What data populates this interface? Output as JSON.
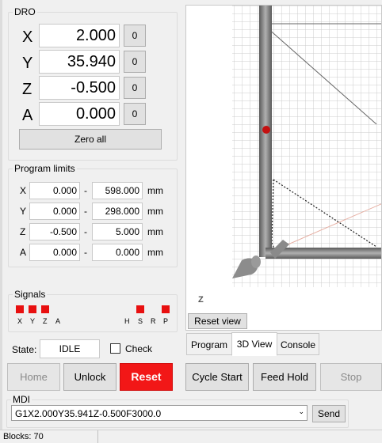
{
  "dro": {
    "title": "DRO",
    "axes": [
      {
        "label": "X",
        "value": "2.000",
        "zero": "0"
      },
      {
        "label": "Y",
        "value": "35.940",
        "zero": "0"
      },
      {
        "label": "Z",
        "value": "-0.500",
        "zero": "0"
      },
      {
        "label": "A",
        "value": "0.000",
        "zero": "0"
      }
    ],
    "zero_all": "Zero all"
  },
  "limits": {
    "title": "Program limits",
    "rows": [
      {
        "axis": "X",
        "min": "0.000",
        "max": "598.000",
        "unit": "mm"
      },
      {
        "axis": "Y",
        "min": "0.000",
        "max": "298.000",
        "unit": "mm"
      },
      {
        "axis": "Z",
        "min": "-0.500",
        "max": "5.000",
        "unit": "mm"
      },
      {
        "axis": "A",
        "min": "0.000",
        "max": "0.000",
        "unit": "mm"
      }
    ],
    "dash": "-"
  },
  "signals": {
    "title": "Signals",
    "labels": [
      "X",
      "Y",
      "Z",
      "A",
      "H",
      "S",
      "R",
      "P"
    ],
    "led_color": "#e81010"
  },
  "state": {
    "label": "State:",
    "value": "IDLE",
    "check_label": "Check"
  },
  "buttons": {
    "home": "Home",
    "unlock": "Unlock",
    "reset": "Reset",
    "cycle_start": "Cycle Start",
    "feed_hold": "Feed Hold",
    "stop": "Stop"
  },
  "mdi": {
    "title": "MDI",
    "value": "G1X2.000Y35.941Z-0.500F3000.0",
    "send": "Send"
  },
  "view": {
    "axis_label": "Z",
    "reset_view": "Reset view",
    "tabs": [
      "Program",
      "3D View",
      "Console"
    ],
    "active_tab": "3D View"
  },
  "status": {
    "blocks": "Blocks: 70"
  },
  "colors": {
    "reset_red": "#f21717",
    "led_red": "#e81010"
  }
}
